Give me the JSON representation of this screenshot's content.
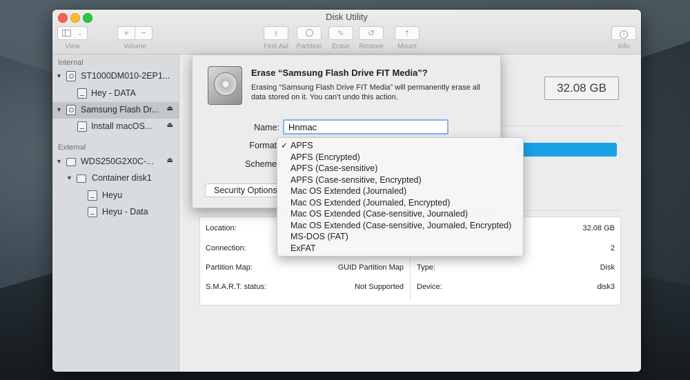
{
  "window": {
    "title": "Disk Utility"
  },
  "toolbar": {
    "view_label": "View",
    "volume_label": "Volume",
    "first_aid_label": "First Aid",
    "partition_label": "Partition",
    "erase_label": "Erase",
    "restore_label": "Restore",
    "mount_label": "Mount",
    "info_label": "Info",
    "volume_add": "+",
    "volume_remove": "−"
  },
  "sidebar": {
    "internal_header": "Internal",
    "external_header": "External",
    "items": [
      {
        "label": "ST1000DM010-2EP1...",
        "selected": false
      },
      {
        "label": "Hey - DATA",
        "selected": false
      },
      {
        "label": "Samsung Flash Dr...",
        "selected": true
      },
      {
        "label": "Install macOS...",
        "selected": false
      },
      {
        "label": "WDS250G2X0C-...",
        "selected": false
      },
      {
        "label": "Container disk1",
        "selected": false
      },
      {
        "label": "Heyu",
        "selected": false
      },
      {
        "label": "Heyu - Data",
        "selected": false
      }
    ]
  },
  "main": {
    "capacity": "32.08 GB",
    "info_rows": [
      {
        "label": "Location:",
        "value": ""
      },
      {
        "label": "Connection:",
        "value": ""
      },
      {
        "label": "Partition Map:",
        "value": "GUID Partition Map"
      },
      {
        "label": "S.M.A.R.T. status:",
        "value": "Not Supported"
      }
    ],
    "info_rows_right": [
      {
        "label": "",
        "value": "32.08 GB"
      },
      {
        "label": "",
        "value": "2"
      },
      {
        "label": "Type:",
        "value": "Disk"
      },
      {
        "label": "Device:",
        "value": "disk3"
      }
    ]
  },
  "erase_dialog": {
    "title": "Erase “Samsung Flash Drive FIT Media”?",
    "description": "Erasing “Samsung Flash Drive FIT Media” will permanently erase all data stored on it. You can’t undo this action.",
    "name_label": "Name:",
    "name_value": "Hnmac",
    "format_label": "Format",
    "scheme_label": "Scheme",
    "security_options_label": "Security Options"
  },
  "format_menu": {
    "selected_index": 0,
    "check_glyph": "✓",
    "options": [
      "APFS",
      "APFS (Encrypted)",
      "APFS (Case-sensitive)",
      "APFS (Case-sensitive, Encrypted)",
      "Mac OS Extended (Journaled)",
      "Mac OS Extended (Journaled, Encrypted)",
      "Mac OS Extended (Case-sensitive, Journaled)",
      "Mac OS Extended (Case-sensitive, Journaled, Encrypted)",
      "MS-DOS (FAT)",
      "ExFAT"
    ]
  },
  "colors": {
    "accent_blue": "#1aa1e6",
    "focus_ring": "#7fb5f2",
    "sidebar_bg": "#d9dcdf",
    "sidebar_selected": "#c2c5c9"
  },
  "icons": [
    "sidebar-toggle-icon",
    "chevron-down-icon",
    "stethoscope-icon",
    "pie-icon",
    "erase-icon",
    "restore-icon",
    "mount-icon",
    "info-icon",
    "disclosure-triangle-icon",
    "disk-icon",
    "eject-icon",
    "hard-drive-icon"
  ]
}
